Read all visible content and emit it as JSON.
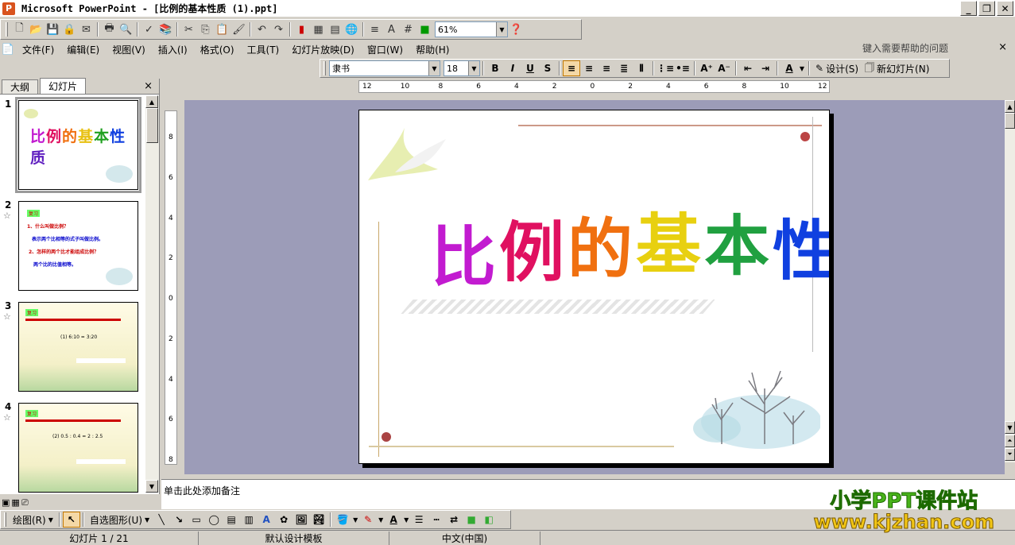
{
  "window": {
    "title": "Microsoft PowerPoint - [比例的基本性质 (1).ppt]",
    "app_icon": "powerpoint-icon",
    "controls": [
      "minimize-icon",
      "restore-icon",
      "close-icon"
    ]
  },
  "standard_toolbar": {
    "zoom": "61%",
    "icons": [
      "new-icon",
      "open-icon",
      "save-icon",
      "permission-icon",
      "email-icon",
      "print-icon",
      "print-preview-icon",
      "spelling-icon",
      "research-icon",
      "cut-icon",
      "copy-icon",
      "paste-icon",
      "format-painter-icon",
      "undo-icon",
      "redo-icon",
      "insert-chart-icon",
      "insert-table-icon",
      "tables-borders-icon",
      "insert-hyperlink-icon",
      "expand-icon",
      "show-formatting-icon",
      "show-grid-icon",
      "color-grayscale-icon",
      "help-icon"
    ]
  },
  "menu": {
    "items": [
      "文件(F)",
      "编辑(E)",
      "视图(V)",
      "插入(I)",
      "格式(O)",
      "工具(T)",
      "幻灯片放映(D)",
      "窗口(W)",
      "帮助(H)"
    ],
    "help_placeholder": "键入需要帮助的问题",
    "close": "×"
  },
  "formatting_toolbar": {
    "font": "隶书",
    "size": "18",
    "bold": "B",
    "italic": "I",
    "underline": "U",
    "shadow": "S",
    "font_color_letter": "A",
    "design_label": "设计(S)",
    "new_slide_label": "新幻灯片(N)"
  },
  "left_pane": {
    "tabs": [
      "大纲",
      "幻灯片"
    ],
    "close": "×",
    "slides": [
      {
        "num": "1",
        "star": ""
      },
      {
        "num": "2",
        "star": "☆"
      },
      {
        "num": "3",
        "star": "☆"
      },
      {
        "num": "4",
        "star": "☆"
      }
    ],
    "slide2_heading": "复习",
    "slide2_lines": [
      "1、什么叫做比例？",
      "表示两个比相等的式子叫做比例。",
      "2、怎样的两个比才能组成比例？",
      "两个比的比值相等。"
    ],
    "slide3_heading": "复习",
    "slide3_expr": "(1) 6:10 = 3:20",
    "slide4_heading": "复习",
    "slide4_expr": "(2) 0.5 : 0.4 = 2 : 2.5"
  },
  "rulers": {
    "h_labels": [
      "12",
      "10",
      "8",
      "6",
      "4",
      "2",
      "0",
      "2",
      "4",
      "6",
      "8",
      "10",
      "12"
    ],
    "v_labels": [
      "8",
      "6",
      "4",
      "2",
      "0",
      "2",
      "4",
      "6",
      "8"
    ]
  },
  "slide": {
    "title_chars": [
      "比",
      "例",
      "的",
      "基",
      "本",
      "性",
      "质"
    ],
    "title_colors": [
      "#c21bd0",
      "#e01060",
      "#f07010",
      "#e8e010",
      "#20a020",
      "#1040e0",
      "#6020c0"
    ]
  },
  "notes": {
    "placeholder": "单击此处添加备注"
  },
  "drawing_toolbar": {
    "draw_label": "绘图(R)",
    "autoshape_label": "自选图形(U)"
  },
  "status": {
    "slide_info": "幻灯片 1 / 21",
    "template": "默认设计模板",
    "language": "中文(中国)"
  },
  "watermark": {
    "line1": "小学PPT课件站",
    "line2": "www.kjzhan.com"
  }
}
